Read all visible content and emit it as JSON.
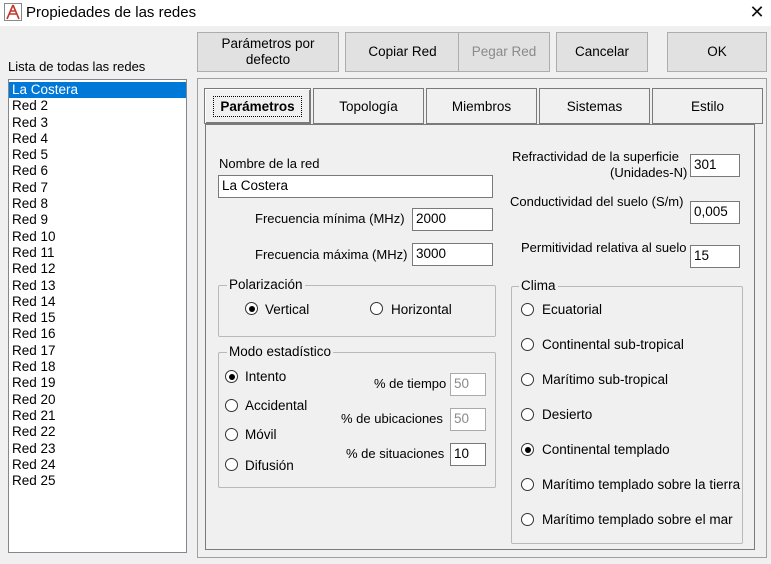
{
  "window": {
    "title": "Propiedades de las redes",
    "close_icon": "close-icon",
    "app_icon": "antenna-app-icon"
  },
  "list": {
    "label": "Lista de todas las redes",
    "items": [
      "La Costera",
      "Red  2",
      "Red  3",
      "Red  4",
      "Red  5",
      "Red  6",
      "Red  7",
      "Red  8",
      "Red  9",
      "Red 10",
      "Red 11",
      "Red 12",
      "Red 13",
      "Red 14",
      "Red 15",
      "Red 16",
      "Red 17",
      "Red 18",
      "Red 19",
      "Red 20",
      "Red 21",
      "Red 22",
      "Red 23",
      "Red 24",
      "Red 25"
    ],
    "selected": "La Costera"
  },
  "toolbar": {
    "defaults": "Parámetros por defecto",
    "copy": "Copiar Red",
    "paste": "Pegar Red",
    "cancel": "Cancelar",
    "ok": "OK"
  },
  "tabs": [
    "Parámetros",
    "Topología",
    "Miembros",
    "Sistemas",
    "Estilo"
  ],
  "active_tab": "Parámetros",
  "params": {
    "name_label": "Nombre de la red",
    "name_value": "La Costera",
    "fmin_label": "Frecuencia mínima (MHz)",
    "fmin_value": "2000",
    "fmax_label": "Frecuencia máxima (MHz)",
    "fmax_value": "3000",
    "refr_label_1": "Refractividad de la superficie",
    "refr_label_2": "(Unidades-N)",
    "refr_value": "301",
    "cond_label": "Conductividad del suelo (S/m)",
    "cond_value": "0,005",
    "perm_label": "Permitividad relativa al suelo",
    "perm_value": "15"
  },
  "polarization": {
    "title": "Polarización",
    "options": [
      "Vertical",
      "Horizontal"
    ],
    "selected": "Vertical"
  },
  "stat_mode": {
    "title": "Modo estadístico",
    "options": [
      "Intento",
      "Accidental",
      "Móvil",
      "Difusión"
    ],
    "selected": "Intento",
    "time_label": "% de tiempo",
    "time_value": "50",
    "loc_label": "% de ubicaciones",
    "loc_value": "50",
    "sit_label": "% de situaciones",
    "sit_value": "10"
  },
  "climate": {
    "title": "Clima",
    "options": [
      "Ecuatorial",
      "Continental sub-tropical",
      "Marítimo sub-tropical",
      "Desierto",
      "Continental templado",
      "Marítimo templado sobre la tierra",
      "Marítimo templado sobre el mar"
    ],
    "selected": "Continental templado"
  }
}
